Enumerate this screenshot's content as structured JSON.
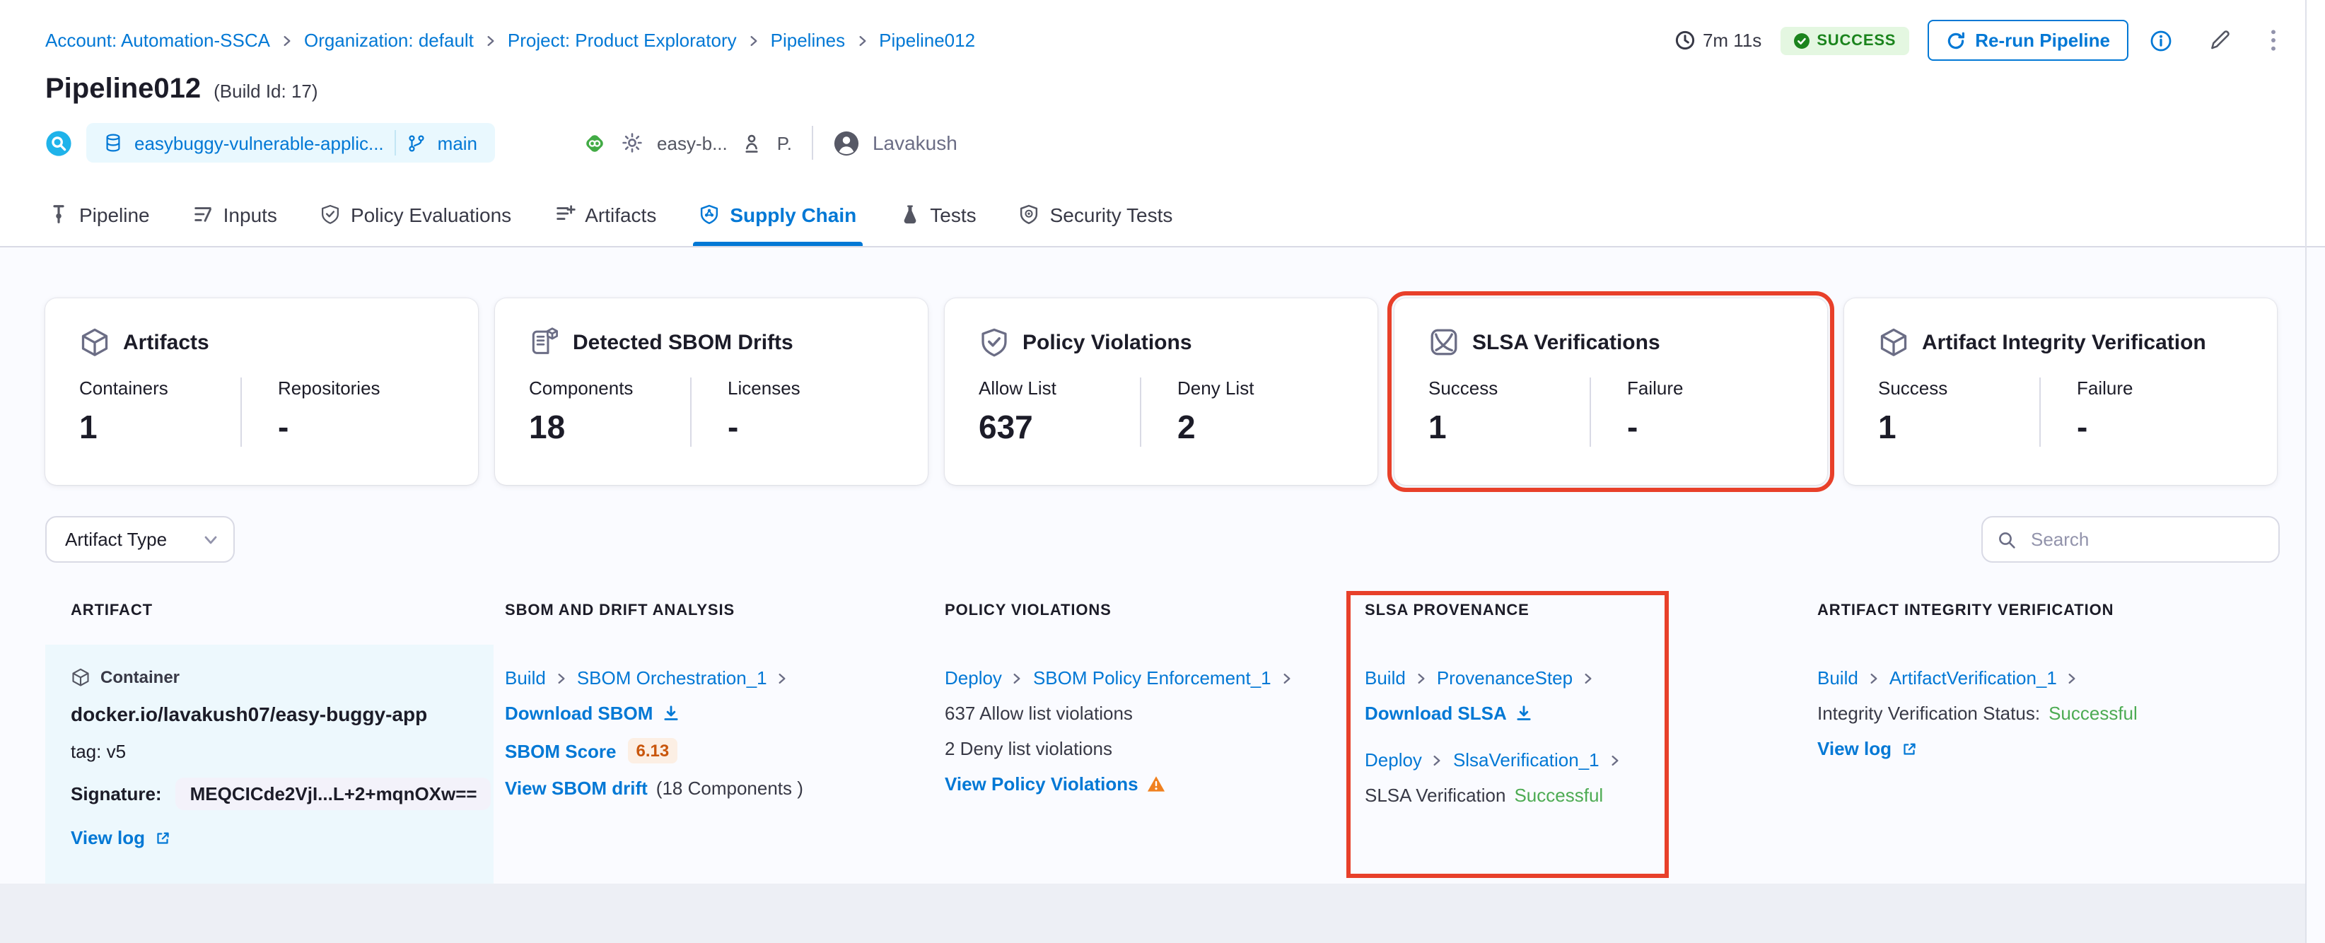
{
  "breadcrumb": {
    "items": [
      {
        "label": "Account: Automation-SSCA"
      },
      {
        "label": "Organization: default"
      },
      {
        "label": "Project: Product Exploratory"
      },
      {
        "label": "Pipelines"
      },
      {
        "label": "Pipeline012"
      }
    ]
  },
  "run_meta": {
    "duration": "7m 11s",
    "status": "SUCCESS",
    "rerun_label": "Re-run Pipeline"
  },
  "header": {
    "title": "Pipeline012",
    "build_id": "(Build Id: 17)",
    "repo_name": "easybuggy-vulnerable-applic...",
    "branch": "main",
    "service_name": "easy-b...",
    "env_short": "P.",
    "user_name": "Lavakush"
  },
  "tabs": [
    {
      "label": "Pipeline"
    },
    {
      "label": "Inputs"
    },
    {
      "label": "Policy Evaluations"
    },
    {
      "label": "Artifacts"
    },
    {
      "label": "Supply Chain"
    },
    {
      "label": "Tests"
    },
    {
      "label": "Security Tests"
    }
  ],
  "summary_cards": [
    {
      "title": "Artifacts",
      "stats": [
        {
          "label": "Containers",
          "value": "1"
        },
        {
          "label": "Repositories",
          "value": "-"
        }
      ]
    },
    {
      "title": "Detected SBOM Drifts",
      "stats": [
        {
          "label": "Components",
          "value": "18"
        },
        {
          "label": "Licenses",
          "value": "-"
        }
      ]
    },
    {
      "title": "Policy Violations",
      "stats": [
        {
          "label": "Allow List",
          "value": "637"
        },
        {
          "label": "Deny List",
          "value": "2"
        }
      ]
    },
    {
      "title": "SLSA Verifications",
      "highlighted": true,
      "stats": [
        {
          "label": "Success",
          "value": "1"
        },
        {
          "label": "Failure",
          "value": "-"
        }
      ]
    },
    {
      "title": "Artifact Integrity Verification",
      "stats": [
        {
          "label": "Success",
          "value": "1"
        },
        {
          "label": "Failure",
          "value": "-"
        }
      ]
    }
  ],
  "filters": {
    "artifact_type_label": "Artifact Type",
    "search_placeholder": "Search"
  },
  "table": {
    "columns": [
      "ARTIFACT",
      "SBOM AND DRIFT ANALYSIS",
      "POLICY VIOLATIONS",
      "SLSA PROVENANCE",
      "ARTIFACT INTEGRITY VERIFICATION"
    ],
    "row": {
      "artifact": {
        "type_label": "Container",
        "image": "docker.io/lavakush07/easy-buggy-app",
        "tag": "tag: v5",
        "signature_label": "Signature:",
        "signature_value": "MEQCICde2VjI...L+2+mqnOXw==",
        "view_log": "View log"
      },
      "sbom": {
        "stage": "Build",
        "step": "SBOM Orchestration_1",
        "download_label": "Download SBOM",
        "score_label": "SBOM Score",
        "score_value": "6.13",
        "drift_label": "View SBOM drift",
        "drift_count": "(18 Components )"
      },
      "policy": {
        "stage": "Deploy",
        "step": "SBOM Policy Enforcement_1",
        "allow_text": "637 Allow list violations",
        "deny_text": "2 Deny list violations",
        "view_label": "View Policy Violations"
      },
      "slsa": {
        "stage1": "Build",
        "step1": "ProvenanceStep",
        "download_label": "Download SLSA",
        "stage2": "Deploy",
        "step2": "SlsaVerification_1",
        "status_label": "SLSA Verification",
        "status_value": "Successful"
      },
      "integrity": {
        "stage": "Build",
        "step": "ArtifactVerification_1",
        "status_label": "Integrity Verification Status:",
        "status_value": "Successful",
        "view_log": "View log"
      }
    }
  },
  "colors": {
    "accent_blue": "#0278d5",
    "success_badge_text": "#1b841d",
    "success_badge_bg": "#e4f7e1",
    "status_green": "#4dab53",
    "highlight_red": "#e8402a",
    "warning_orange": "#f0801f",
    "score_text": "#c9560c",
    "score_bg": "#fcefe4"
  }
}
